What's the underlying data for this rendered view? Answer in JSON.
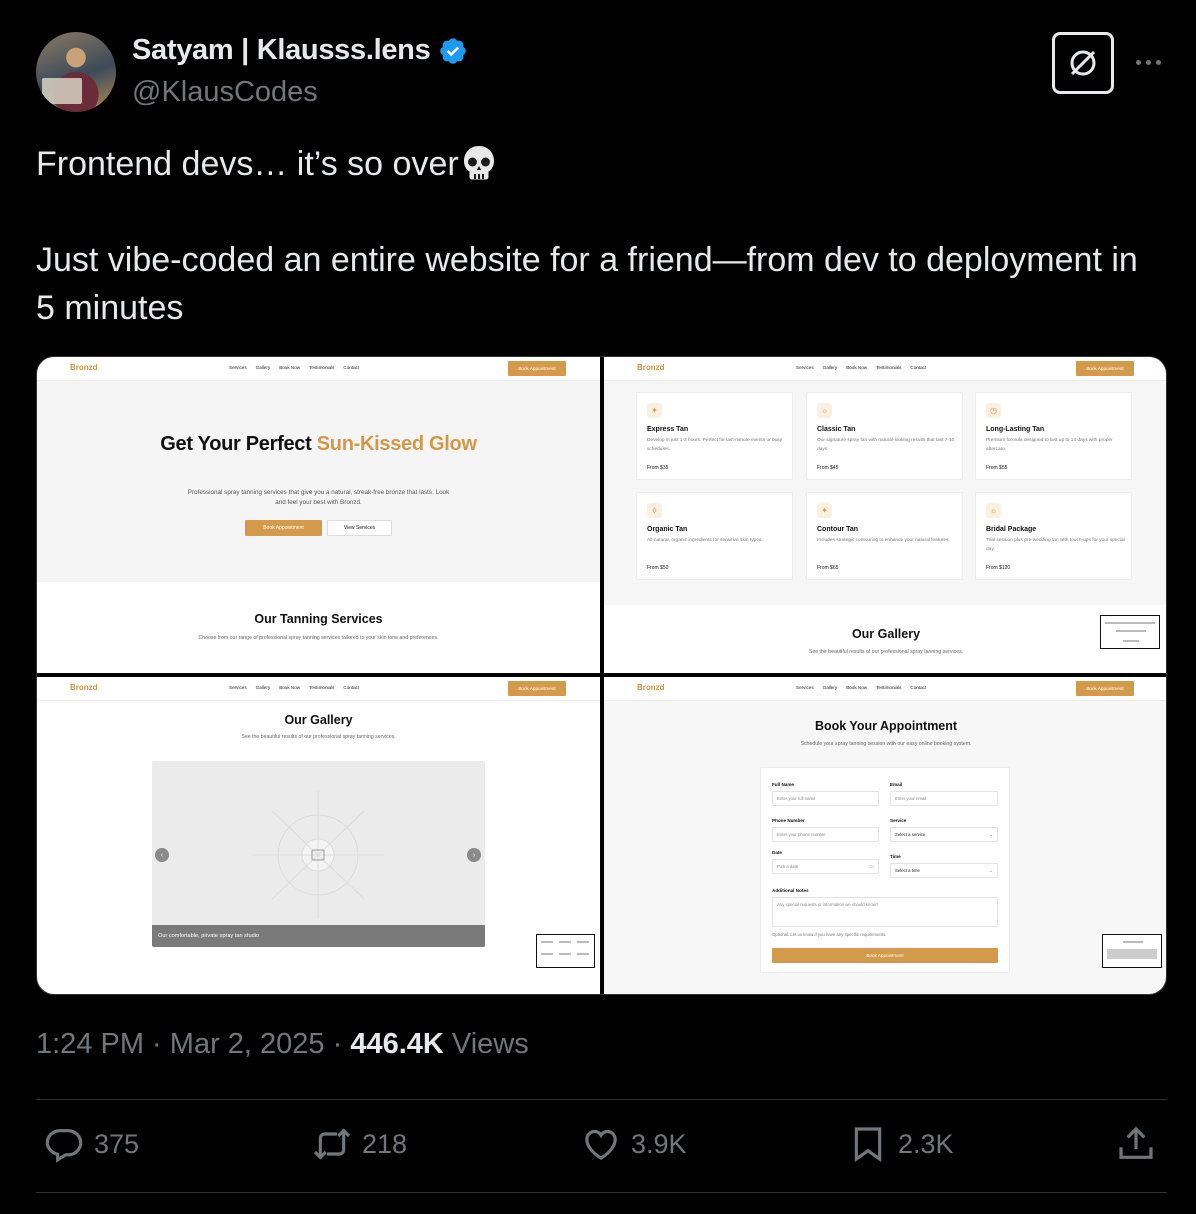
{
  "author": {
    "display_name": "Satyam | Klausss.lens",
    "handle": "@KlausCodes",
    "verified": true,
    "verified_color": "#1d9bf0"
  },
  "tweet": {
    "line1": "Frontend devs… it’s so over",
    "line1_emoji": "skull",
    "line2": "Just vibe-coded an entire website for a friend—from dev to deployment in 5 minutes"
  },
  "media": {
    "brand_color": "#d49a4c",
    "nav": {
      "brand": "Bronzd",
      "links": [
        "Services",
        "Gallery",
        "Book Now",
        "Testimonials",
        "Contact"
      ],
      "cta": "Book Appointment"
    },
    "hero": {
      "title_plain": "Get Your Perfect ",
      "title_accent": "Sun-Kissed Glow",
      "subtitle": "Professional spray tanning services that give you a natural, streak-free bronze that lasts. Look and feel your best with Bronzd.",
      "primary_button": "Book Appointment",
      "secondary_button": "View Services"
    },
    "services_section": {
      "title": "Our Tanning Services",
      "subtitle": "Choose from our range of professional spray tanning services tailored to your skin tone and preferences."
    },
    "services": [
      {
        "name": "Express Tan",
        "desc": "Develop in just 1-3 hours. Perfect for last-minute events or busy schedules.",
        "price": "From $35",
        "icon": "sparkle-icon"
      },
      {
        "name": "Classic Tan",
        "desc": "Our signature spray tan with natural-looking results that last 7-10 days.",
        "price": "From $45",
        "icon": "sun-icon"
      },
      {
        "name": "Long-Lasting Tan",
        "desc": "Premium formula designed to last up to 14 days with proper aftercare.",
        "price": "From $55",
        "icon": "clock-icon"
      },
      {
        "name": "Organic Tan",
        "desc": "All-natural, organic ingredients for sensitive skin types.",
        "price": "From $50",
        "icon": "shield-icon"
      },
      {
        "name": "Contour Tan",
        "desc": "Includes strategic contouring to enhance your natural features.",
        "price": "From $65",
        "icon": "sparkle-icon"
      },
      {
        "name": "Bridal Package",
        "desc": "Trial session plus pre-wedding tan with touch-ups for your special day.",
        "price": "From $120",
        "icon": "sun-icon"
      }
    ],
    "gallery_section": {
      "title": "Our Gallery",
      "subtitle": "See the beautiful results of our professional spray tanning services.",
      "caption": "Our comfortable, private spray tan studio"
    },
    "booking": {
      "title": "Book Your Appointment",
      "subtitle": "Schedule your spray tanning session with our easy online booking system.",
      "full_name_label": "Full Name",
      "full_name_placeholder": "Enter your full name",
      "email_label": "Email",
      "email_placeholder": "Enter your email",
      "phone_label": "Phone Number",
      "phone_placeholder": "Enter your phone number",
      "service_label": "Service",
      "service_placeholder": "Select a service",
      "date_label": "Date",
      "date_placeholder": "Pick a date",
      "time_label": "Time",
      "time_placeholder": "Select a time",
      "notes_label": "Additional Notes",
      "notes_placeholder": "Any special requests or information we should know?",
      "notes_hint": "Optional: Let us know if you have any specific requirements.",
      "submit": "Book Appointment"
    }
  },
  "meta": {
    "time": "1:24 PM",
    "date": "Mar 2, 2025",
    "views_count": "446.4K",
    "views_label": "Views"
  },
  "actions": {
    "replies": "375",
    "reposts": "218",
    "likes": "3.9K",
    "bookmarks": "2.3K"
  }
}
